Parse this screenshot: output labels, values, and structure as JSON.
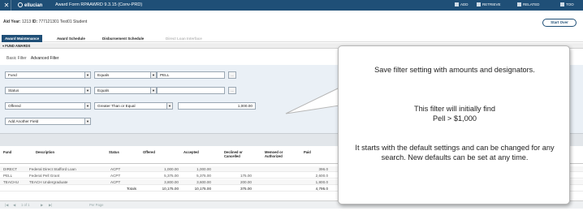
{
  "topbar": {
    "close_glyph": "✕",
    "brand": "ellucian",
    "title": "Award Form RPAAWRD 9.3.15 (Conv-PRD)",
    "actions": [
      {
        "label": "ADD",
        "icon": "add-icon"
      },
      {
        "label": "RETRIEVE",
        "icon": "retrieve-icon"
      },
      {
        "label": "RELATED",
        "icon": "related-icon"
      },
      {
        "label": "TOO",
        "icon": "tools-icon"
      }
    ]
  },
  "context": {
    "aid_year_label": "Aid Year:",
    "aid_year_value": "1213",
    "id_label": "ID:",
    "id_value": "777121301",
    "student_name": "Test01 Student"
  },
  "start_over": "Start Over",
  "tabs": [
    {
      "label": "Award Maintenance",
      "state": "active"
    },
    {
      "label": "Award Schedule",
      "state": "normal"
    },
    {
      "label": "Disbursement Schedule",
      "state": "normal"
    },
    {
      "label": "Direct Loan Interface",
      "state": "disabled"
    }
  ],
  "section_title": "FUND AWARDS",
  "filter_tabs": {
    "basic": "Basic Filter",
    "advanced": "Advanced Filter"
  },
  "filters": [
    {
      "field": "Fund",
      "operator": "Equals",
      "value": "PELL"
    },
    {
      "field": "Status",
      "operator": "Equals",
      "value": ""
    },
    {
      "field": "Offered",
      "operator": "Greater Than or Equal",
      "value": "1,000.00"
    }
  ],
  "add_field": "Add Another Field",
  "dots": "...",
  "columns": [
    "Fund",
    "Description",
    "Status",
    "Offered",
    "Accepted",
    "Declined or Cancelled",
    "Memoed or Authorized",
    "Paid"
  ],
  "rows": [
    {
      "fund": "DIRECT",
      "description": "Federal Direct Stafford Loan",
      "status": "ACPT",
      "offered": "1,000.00",
      "accepted": "1,000.00",
      "declined": "",
      "paid": "396.0"
    },
    {
      "fund": "PELL",
      "description": "Federal Pell Grant",
      "status": "ACPT",
      "offered": "5,375.00",
      "accepted": "5,375.00",
      "declined": "175.00",
      "paid": "2,600.0"
    },
    {
      "fund": "TEACHU",
      "description": "TEACH Undergraduate",
      "status": "ACPT",
      "offered": "3,800.00",
      "accepted": "3,600.00",
      "declined": "200.00",
      "paid": "1,800.0"
    }
  ],
  "totals": {
    "label": "Totals",
    "offered": "10,175.00",
    "accepted": "10,175.00",
    "declined": "375.00",
    "paid": "4,795.0"
  },
  "pager": {
    "page_text": "1 of 1",
    "per_page": "Per Page"
  },
  "callout": {
    "line1": "Save filter setting with amounts and designators.",
    "line2": "This filter will initially find",
    "line3": "Pell > $1,000",
    "line4": "It starts with the default settings and can be changed for any search. New defaults can be set at any time."
  },
  "colors": {
    "header": "#1f4f77",
    "filter_bg": "#eaf0f6"
  }
}
